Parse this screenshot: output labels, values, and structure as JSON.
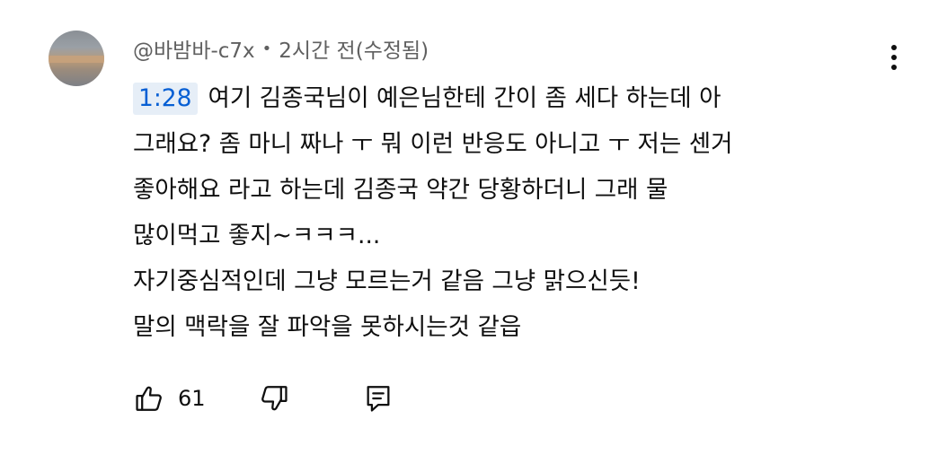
{
  "comment": {
    "author": "@바밤바-c7x",
    "separator": "•",
    "time": "2시간 전(수정됨)",
    "timestamp_link": "1:28",
    "lines": [
      "여기 김종국님이 예은님한테 간이 좀 세다 하는데 아",
      "그래요? 좀 마니 짜나 ㅜ 뭐 이런 반응도 아니고 ㅜ 저는 센거",
      "좋아해요 라고 하는데 김종국 약간 당황하더니 그래 물",
      "많이먹고 좋지~ㅋㅋㅋ...",
      "자기중심적인데 그냥 모르는거 같음 그냥 맑으신듯!",
      "말의 맥락을 잘 파악을 못하시는것 같읍"
    ],
    "like_count": "61"
  },
  "icons": {
    "more": "more-vertical-icon",
    "like": "thumb-up-icon",
    "dislike": "thumb-down-icon",
    "reply": "reply-comment-icon"
  },
  "colors": {
    "text": "#0f0f0f",
    "meta": "#606060",
    "link": "#065fd4",
    "timestamp_bg": "#e6eef7"
  }
}
